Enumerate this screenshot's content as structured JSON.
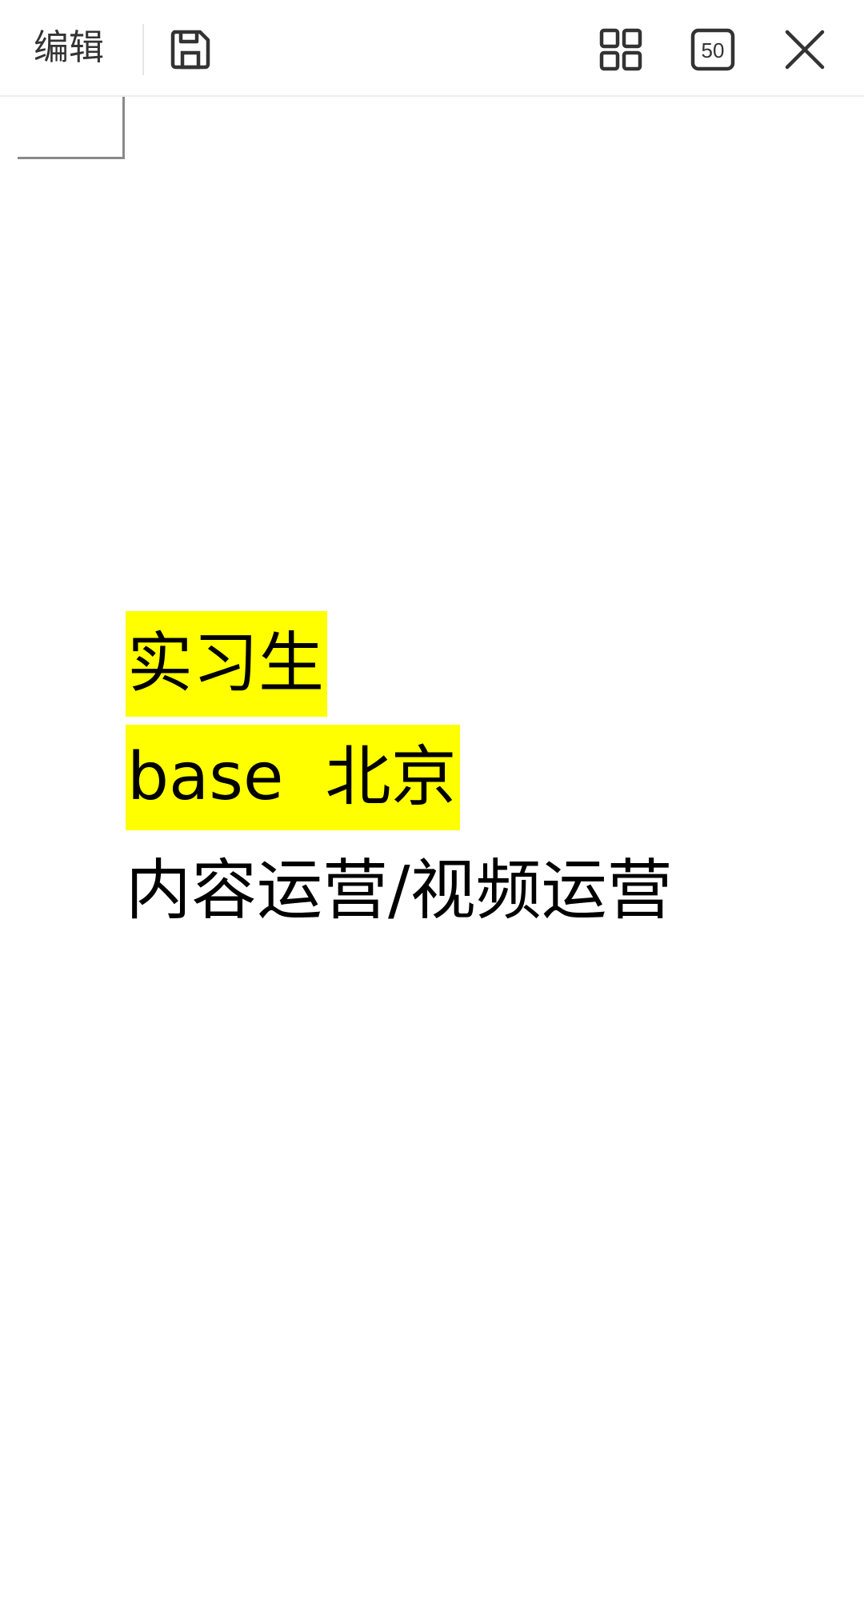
{
  "toolbar": {
    "edit_label": "编辑",
    "save_icon": "save-icon",
    "grid_icon": "grid-icon",
    "count_label": "50",
    "close_icon": "close-icon"
  },
  "content": {
    "lines": [
      {
        "text": "实习生",
        "highlight": "#ffff00"
      },
      {
        "text": "base  北京",
        "highlight": "#ffff00"
      },
      {
        "text": "内容运营/视频运营",
        "highlight": null
      }
    ]
  },
  "colors": {
    "highlight": "#ffff00",
    "text": "#000000",
    "toolbar_text": "#333333"
  }
}
